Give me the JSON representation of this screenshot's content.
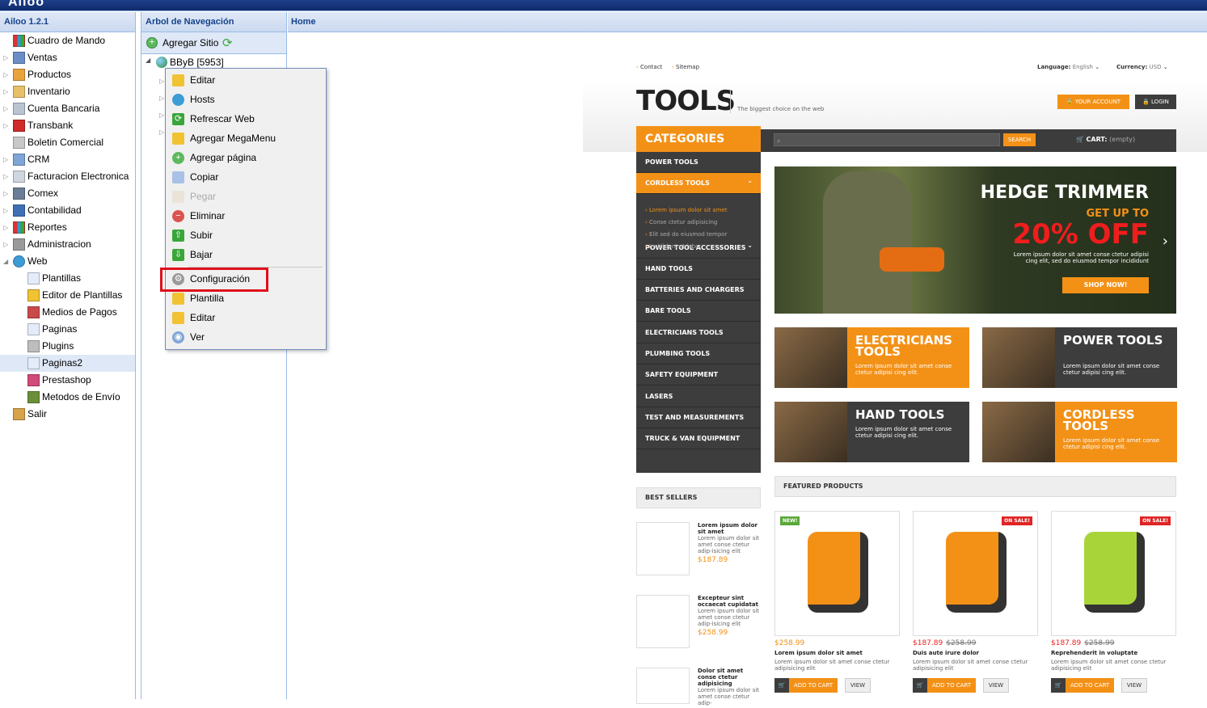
{
  "app": {
    "logo": "Ailoo",
    "version_label": "Ailoo 1.2.1"
  },
  "left_menu": [
    {
      "label": "Cuadro de Mando",
      "icon": "chart-icon",
      "expandable": false
    },
    {
      "label": "Ventas",
      "icon": "sales-icon",
      "expandable": true
    },
    {
      "label": "Productos",
      "icon": "folder-icon",
      "expandable": true
    },
    {
      "label": "Inventario",
      "icon": "box-icon",
      "expandable": true
    },
    {
      "label": "Cuenta Bancaria",
      "icon": "document-icon",
      "expandable": true
    },
    {
      "label": "Transbank",
      "icon": "transbank-icon",
      "expandable": true
    },
    {
      "label": "Boletin Comercial",
      "icon": "tag-icon",
      "expandable": false
    },
    {
      "label": "CRM",
      "icon": "people-icon",
      "expandable": true
    },
    {
      "label": "Facturacion Electronica",
      "icon": "invoice-icon",
      "expandable": true
    },
    {
      "label": "Comex",
      "icon": "truck-icon",
      "expandable": true
    },
    {
      "label": "Contabilidad",
      "icon": "book-icon",
      "expandable": true
    },
    {
      "label": "Reportes",
      "icon": "chart-icon",
      "expandable": true
    },
    {
      "label": "Administracion",
      "icon": "gear-icon",
      "expandable": true
    },
    {
      "label": "Web",
      "icon": "globe-icon",
      "expandable": true,
      "expanded": true
    },
    {
      "label": "Plantillas",
      "icon": "page-icon",
      "child": true
    },
    {
      "label": "Editor de Plantillas",
      "icon": "folder-edit-icon",
      "child": true
    },
    {
      "label": "Medios de Pagos",
      "icon": "payment-icon",
      "child": true
    },
    {
      "label": "Paginas",
      "icon": "page-icon",
      "child": true
    },
    {
      "label": "Plugins",
      "icon": "plugin-icon",
      "child": true
    },
    {
      "label": "Paginas2",
      "icon": "page-icon",
      "child": true,
      "selected": true
    },
    {
      "label": "Prestashop",
      "icon": "prestashop-icon",
      "child": true
    },
    {
      "label": "Metodos de Envío",
      "icon": "shipping-icon",
      "child": true
    },
    {
      "label": "Salir",
      "icon": "exit-icon",
      "expandable": false
    }
  ],
  "nav_tree": {
    "title": "Arbol de Navegación",
    "add_site": "Agregar Sitio",
    "root_node": "BByB [5953]"
  },
  "context_menu": [
    {
      "label": "Editar",
      "icon": "edit-icon",
      "disabled": false
    },
    {
      "label": "Hosts",
      "icon": "globe-icon",
      "disabled": false
    },
    {
      "label": "Refrescar Web",
      "icon": "refresh-icon",
      "disabled": false
    },
    {
      "label": "Agregar MegaMenu",
      "icon": "megamenu-icon",
      "disabled": false
    },
    {
      "label": "Agregar página",
      "icon": "add-icon",
      "disabled": false
    },
    {
      "label": "Copiar",
      "icon": "copy-icon",
      "disabled": false
    },
    {
      "label": "Pegar",
      "icon": "paste-icon",
      "disabled": true
    },
    {
      "label": "Eliminar",
      "icon": "delete-icon",
      "disabled": false
    },
    {
      "label": "Subir",
      "icon": "arrow-up-icon",
      "disabled": false
    },
    {
      "label": "Bajar",
      "icon": "arrow-down-icon",
      "disabled": false
    },
    {
      "label": "Configuración",
      "icon": "gear-icon",
      "disabled": false,
      "highlighted": true
    },
    {
      "label": "Plantilla",
      "icon": "template-icon",
      "disabled": false
    },
    {
      "label": "Editar",
      "icon": "edit-icon",
      "disabled": false
    },
    {
      "label": "Ver",
      "icon": "eye-icon",
      "disabled": false
    }
  ],
  "main_tab": {
    "title": "Home"
  },
  "store": {
    "top_links": [
      "Contact",
      "Sitemap"
    ],
    "language_label": "Language:",
    "language_value": "English",
    "currency_label": "Currency:",
    "currency_value": "USD",
    "logo": "TOOLS",
    "tagline": "The biggest choice on the web",
    "your_account": "YOUR ACCOUNT",
    "login": "LOGIN",
    "categories_title": "CATEGORIES",
    "search_button": "SEARCH",
    "cart_label": "CART:",
    "cart_value": "(empty)",
    "categories": [
      {
        "label": "POWER TOOLS"
      },
      {
        "label": "CORDLESS TOOLS",
        "active": true
      },
      {
        "label": "POWER TOOL ACCESSORIES"
      },
      {
        "label": "HAND TOOLS"
      },
      {
        "label": "BATTERIES AND CHARGERS"
      },
      {
        "label": "BARE TOOLS"
      },
      {
        "label": "ELECTRICIANS TOOLS"
      },
      {
        "label": "PLUMBING TOOLS"
      },
      {
        "label": "SAFETY EQUIPMENT"
      },
      {
        "label": "LASERS"
      },
      {
        "label": "TEST AND MEASUREMENTS"
      },
      {
        "label": "TRUCK & VAN EQUIPMENT"
      }
    ],
    "subcategories": [
      "Lorem ipsum dolor sit amet",
      "Conse ctetur adipisicing",
      "Elit sed do eiusmod tempor",
      "Incididunt ut labor"
    ],
    "hero": {
      "title": "HEDGE TRIMMER",
      "subtitle": "GET UP TO",
      "offer": "20% OFF",
      "desc": "Lorem ipsum dolor sit amet conse ctetur adipisi cing elit, sed do eiusmod tempor incididunt",
      "button": "SHOP NOW!"
    },
    "tiles": [
      {
        "title": "ELECTRICIANS TOOLS",
        "desc": "Lorem ipsum dolor sit amet conse ctetur adipisi cing elit."
      },
      {
        "title": "POWER TOOLS",
        "desc": "Lorem ipsum dolor sit amet conse ctetur adipisi cing elit."
      },
      {
        "title": "HAND TOOLS",
        "desc": "Lorem ipsum dolor sit amet conse ctetur adipisi cing elit."
      },
      {
        "title": "CORDLESS TOOLS",
        "desc": "Lorem ipsum dolor sit amet conse ctetur adipisi cing elit."
      }
    ],
    "best_sellers_title": "BEST SELLERS",
    "best_sellers": [
      {
        "name": "Lorem ipsum dolor sit amet",
        "desc": "Lorem ipsum dolor sit amet conse ctetur adip-isicing elit",
        "price": "$187.89"
      },
      {
        "name": "Excepteur sint occaecat cupidatat",
        "desc": "Lorem ipsum dolor sit amet conse ctetur adip-isicing elit",
        "price": "$258.99"
      },
      {
        "name": "Dolor sit amet conse ctetur adipisicing",
        "desc": "Lorem ipsum dolor sit amet conse ctetur adip-",
        "price": ""
      }
    ],
    "featured_title": "FEATURED PRODUCTS",
    "products": [
      {
        "badge": "NEW!",
        "price": "$258.99",
        "old_price": "",
        "name": "Lorem ipsum dolor sit amet",
        "desc": "Lorem ipsum dolor sit amet conse ctetur adipisicing elit"
      },
      {
        "badge": "ON SALE!",
        "price": "$187.89",
        "old_price": "$258.99",
        "name": "Duis aute irure dolor",
        "desc": "Lorem ipsum dolor sit amet conse ctetur adipisicing elit"
      },
      {
        "badge": "ON SALE!",
        "price": "$187.89",
        "old_price": "$258.99",
        "name": "Reprehenderit in voluptate",
        "desc": "Lorem ipsum dolor sit amet conse ctetur adipisicing elit"
      }
    ],
    "add_to_cart": "ADD TO CART",
    "view": "VIEW"
  },
  "colors": {
    "accent": "#f39117",
    "panel_header": "#15428b",
    "highlight": "#e0101a",
    "dark": "#3d3d3d"
  }
}
